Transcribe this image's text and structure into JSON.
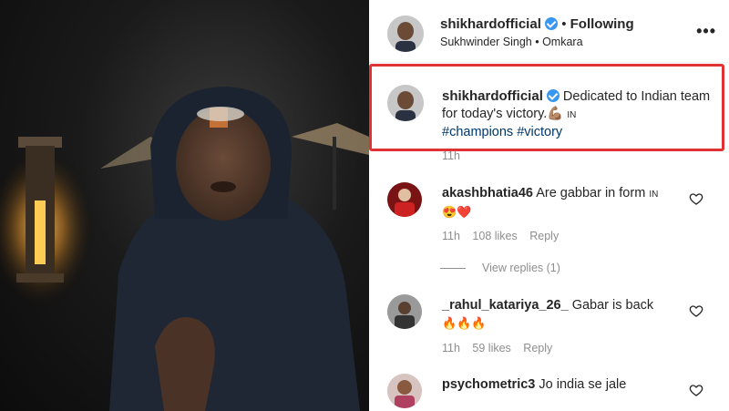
{
  "colors": {
    "accent": "#3897f0",
    "highlight": "#e03232",
    "link": "#00376b",
    "muted": "#8e8e8e"
  },
  "header": {
    "username": "shikhardofficial",
    "separator": "•",
    "follow_label": "Following",
    "audio": "Sukhwinder Singh • Omkara",
    "more_icon": "more-horizontal-icon"
  },
  "caption": {
    "username": "shikhardofficial",
    "text": "Dedicated to Indian team for today's victory.💪🏽",
    "flag": "IN",
    "hashtags": "#champions #victory",
    "time": "11h"
  },
  "comments": [
    {
      "username": "akashbhatia46",
      "text": "Are gabbar in form",
      "flag": "IN",
      "emojis": "😍❤️",
      "time": "11h",
      "likes": "108 likes",
      "reply": "Reply",
      "view_replies": "View replies (1)"
    },
    {
      "username": "_rahul_katariya_26_",
      "text": "Gabar is back",
      "emojis": "🔥🔥🔥",
      "time": "11h",
      "likes": "59 likes",
      "reply": "Reply"
    },
    {
      "username": "psychometric3",
      "text": "Jo india se jale",
      "time": "",
      "likes": "",
      "reply": ""
    }
  ]
}
